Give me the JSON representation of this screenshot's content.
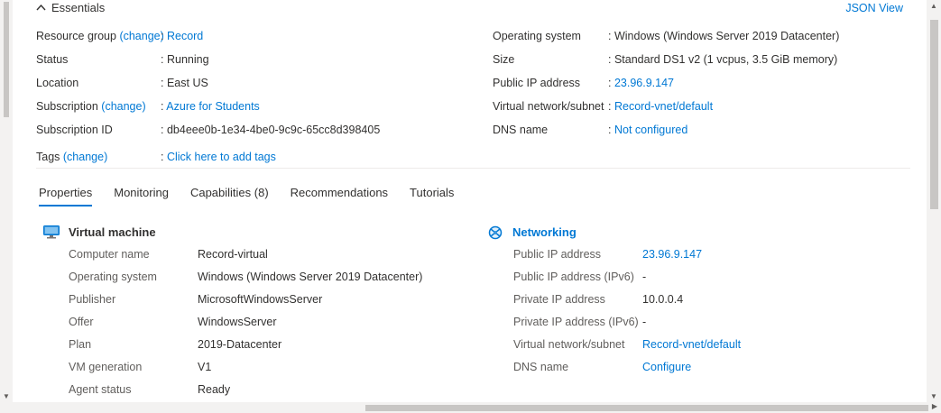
{
  "essentials": {
    "title": "Essentials",
    "json_view": "JSON View",
    "left": [
      {
        "label": "Resource group",
        "change": "(change)",
        "sep": ":",
        "value": "Record",
        "value_link": true
      },
      {
        "label": "Status",
        "change": "",
        "sep": ":",
        "value": "Running",
        "value_link": false
      },
      {
        "label": "Location",
        "change": "",
        "sep": ":",
        "value": "East US",
        "value_link": false
      },
      {
        "label": "Subscription",
        "change": "(change)",
        "sep": ":",
        "value": "Azure for Students",
        "value_link": true
      },
      {
        "label": "Subscription ID",
        "change": "",
        "sep": ":",
        "value": "db4eee0b-1e34-4be0-9c9c-65cc8d398405",
        "value_link": false
      },
      {
        "label": "Tags",
        "change": "(change)",
        "sep": ":",
        "value": "Click here to add tags",
        "value_link": true
      }
    ],
    "right": [
      {
        "label": "Operating system",
        "sep": ":",
        "value": "Windows (Windows Server 2019 Datacenter)",
        "value_link": false
      },
      {
        "label": "Size",
        "sep": ":",
        "value": "Standard DS1 v2 (1 vcpus, 3.5 GiB memory)",
        "value_link": false
      },
      {
        "label": "Public IP address",
        "sep": ":",
        "value": "23.96.9.147",
        "value_link": true
      },
      {
        "label": "Virtual network/subnet",
        "sep": ":",
        "value": "Record-vnet/default",
        "value_link": true
      },
      {
        "label": "DNS name",
        "sep": ":",
        "value": "Not configured",
        "value_link": true
      }
    ]
  },
  "tabs": [
    {
      "label": "Properties",
      "active": true
    },
    {
      "label": "Monitoring",
      "active": false
    },
    {
      "label": "Capabilities (8)",
      "active": false
    },
    {
      "label": "Recommendations",
      "active": false
    },
    {
      "label": "Tutorials",
      "active": false
    }
  ],
  "vm_section": {
    "title": "Virtual machine",
    "icon": "virtual-machine-icon",
    "rows": [
      {
        "label": "Computer name",
        "value": "Record-virtual"
      },
      {
        "label": "Operating system",
        "value": "Windows (Windows Server 2019 Datacenter)"
      },
      {
        "label": "Publisher",
        "value": "MicrosoftWindowsServer"
      },
      {
        "label": "Offer",
        "value": "WindowsServer"
      },
      {
        "label": "Plan",
        "value": "2019-Datacenter"
      },
      {
        "label": "VM generation",
        "value": "V1"
      },
      {
        "label": "Agent status",
        "value": "Ready"
      }
    ]
  },
  "net_section": {
    "title": "Networking",
    "icon": "networking-icon",
    "rows": [
      {
        "label": "Public IP address",
        "value": "23.96.9.147",
        "link": true
      },
      {
        "label": "Public IP address (IPv6)",
        "value": "-",
        "link": false
      },
      {
        "label": "Private IP address",
        "value": "10.0.0.4",
        "link": false
      },
      {
        "label": "Private IP address (IPv6)",
        "value": "-",
        "link": false
      },
      {
        "label": "Virtual network/subnet",
        "value": "Record-vnet/default",
        "link": true
      },
      {
        "label": "DNS name",
        "value": "Configure",
        "link": true
      }
    ]
  },
  "colors": {
    "accent": "#0078d4",
    "text": "#323130",
    "muted": "#605e5c"
  }
}
